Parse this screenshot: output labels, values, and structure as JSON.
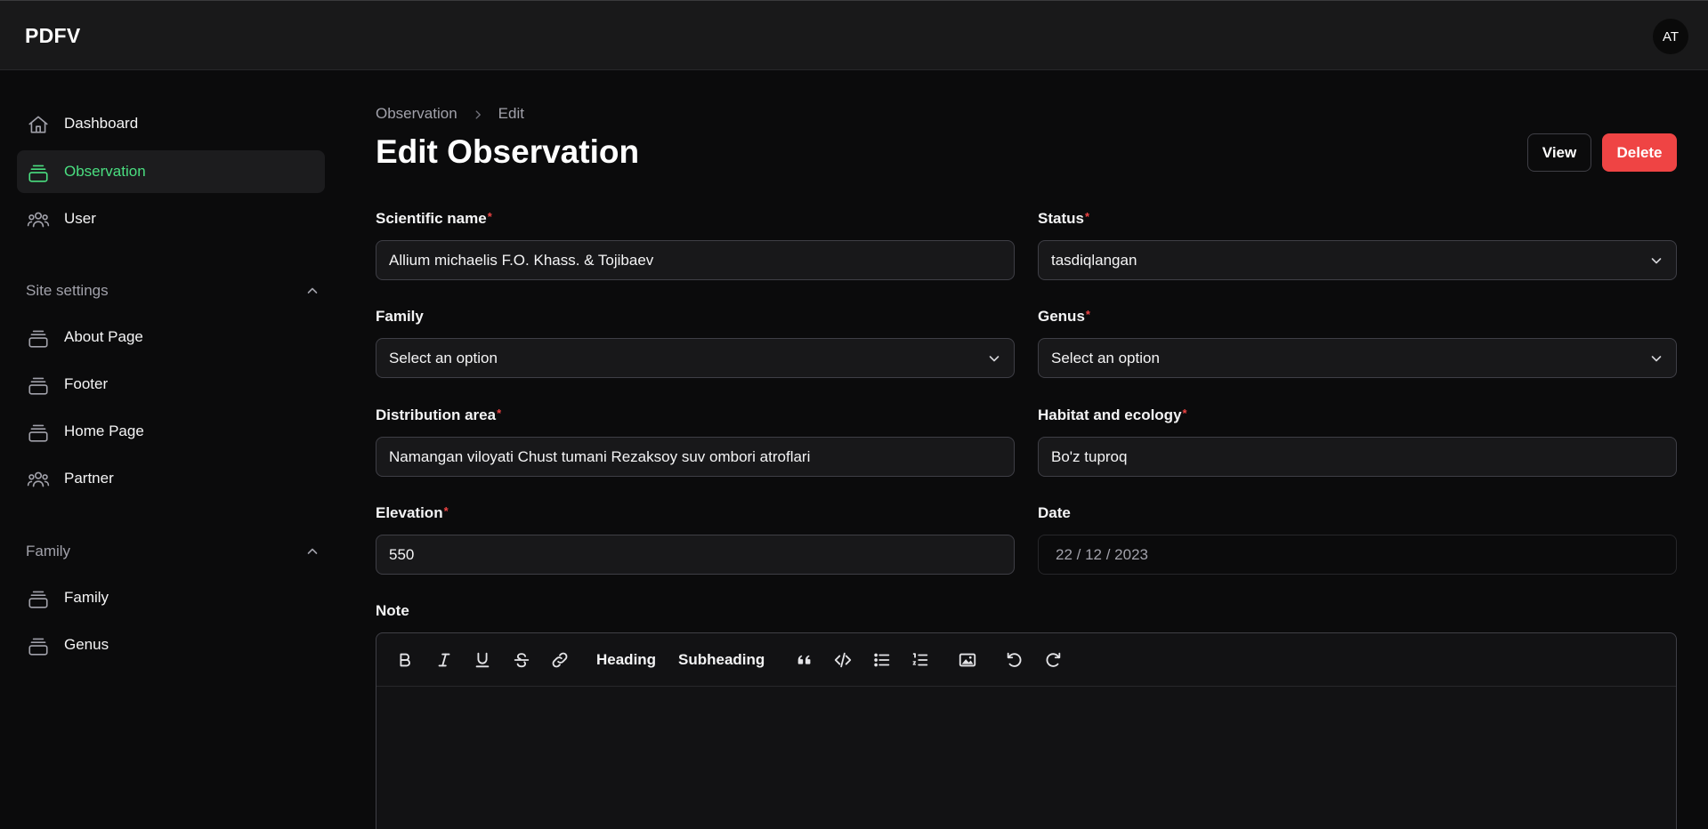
{
  "app": {
    "brand": "PDFV",
    "avatar_initials": "AT"
  },
  "sidebar": {
    "items": [
      {
        "label": "Dashboard",
        "icon": "home-icon"
      },
      {
        "label": "Observation",
        "icon": "collection-icon",
        "active": true
      },
      {
        "label": "User",
        "icon": "users-icon"
      }
    ],
    "groups": [
      {
        "label": "Site settings",
        "items": [
          {
            "label": "About Page",
            "icon": "collection-icon"
          },
          {
            "label": "Footer",
            "icon": "collection-icon"
          },
          {
            "label": "Home Page",
            "icon": "collection-icon"
          },
          {
            "label": "Partner",
            "icon": "users-icon"
          }
        ]
      },
      {
        "label": "Family",
        "items": [
          {
            "label": "Family",
            "icon": "collection-icon"
          },
          {
            "label": "Genus",
            "icon": "collection-icon"
          }
        ]
      }
    ]
  },
  "breadcrumb": [
    "Observation",
    "Edit"
  ],
  "page": {
    "title": "Edit Observation",
    "view_label": "View",
    "delete_label": "Delete"
  },
  "form": {
    "scientific_name": {
      "label": "Scientific name",
      "value": "Allium michaelis F.O. Khass. & Tojibaev",
      "required": true
    },
    "status": {
      "label": "Status",
      "value": "tasdiqlangan",
      "required": true
    },
    "family": {
      "label": "Family",
      "value": "Select an option",
      "required": false
    },
    "genus": {
      "label": "Genus",
      "value": "Select an option",
      "required": true
    },
    "distribution_area": {
      "label": "Distribution area",
      "value": "Namangan viloyati Chust tumani Rezaksoy suv ombori atroflari",
      "required": true
    },
    "habitat": {
      "label": "Habitat and ecology",
      "value": "Bo'z tuproq",
      "required": true
    },
    "elevation": {
      "label": "Elevation",
      "value": "550",
      "required": true
    },
    "date": {
      "label": "Date",
      "value": "22 / 12 / 2023",
      "required": false
    },
    "note": {
      "label": "Note"
    }
  },
  "editor_toolbar": {
    "heading": "Heading",
    "subheading": "Subheading",
    "tools": [
      "bold-icon",
      "italic-icon",
      "underline-icon",
      "strikethrough-icon",
      "link-icon",
      "quote-icon",
      "code-icon",
      "bullet-list-icon",
      "ordered-list-icon",
      "image-icon",
      "undo-icon",
      "redo-icon"
    ]
  },
  "colors": {
    "accent": "#4ade80",
    "danger": "#ef4444",
    "background": "#0b0b0c",
    "topbar": "#19191a"
  }
}
